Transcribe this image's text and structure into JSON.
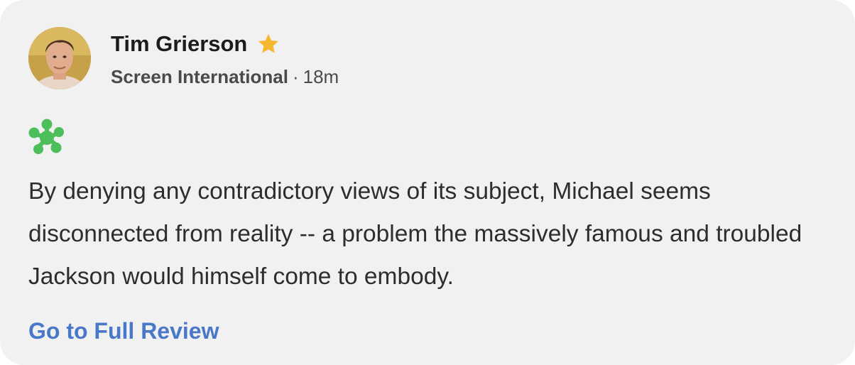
{
  "review": {
    "critic_name": "Tim Grierson",
    "publication": "Screen International",
    "separator": "·",
    "timestamp": "18m",
    "quote": "By denying any contradictory views of its subject, Michael seems disconnected from reality -- a problem the massively famous and troubled Jackson would himself come to embody.",
    "link_label": "Go to Full Review",
    "rating_icon": "rotten-splat-icon",
    "top_critic_icon": "star-icon",
    "avatar_icon": "critic-avatar"
  },
  "colors": {
    "card_background": "#f1f1f1",
    "star": "#f5b82e",
    "rotten_splat": "#4cbf5a",
    "link": "#4a78c8",
    "text_primary": "#1c1c1c",
    "text_secondary": "#4a4a4a",
    "quote_text": "#2d2d2d"
  }
}
